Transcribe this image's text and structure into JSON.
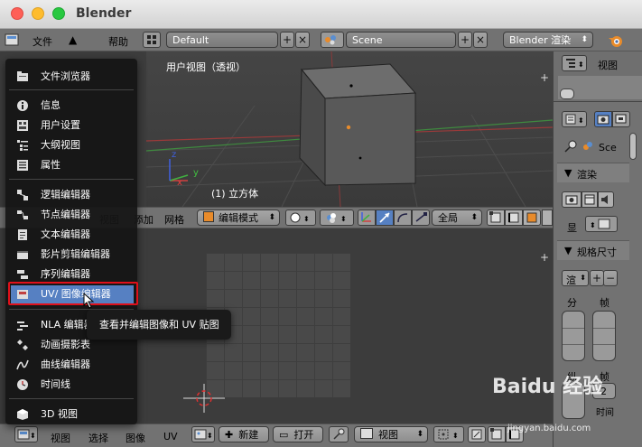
{
  "window": {
    "title": "Blender",
    "traffic_lights": {
      "close": "#fe5f57",
      "minimize": "#febc2e",
      "maximize": "#28c840"
    }
  },
  "top_bar": {
    "file_menu": "文件",
    "add_menu": "添加",
    "help_menu": "帮助",
    "layout": "Default",
    "scene": "Scene",
    "render_engine": "Blender 渲染"
  },
  "viewport": {
    "view_label": "用户视图（透视）",
    "object_label": "(1) 立方体",
    "axis_x": "x",
    "axis_y": "y",
    "axis_z": "z"
  },
  "viewport_header": {
    "view": "视图",
    "add": "添加",
    "mesh": "网格",
    "mode": "编辑模式",
    "orientation": "全局"
  },
  "editor_menu": {
    "items": [
      {
        "label": "文件浏览器",
        "icon": "file-browser-icon"
      },
      {
        "label": "信息",
        "icon": "info-icon"
      },
      {
        "label": "用户设置",
        "icon": "user-preferences-icon"
      },
      {
        "label": "大纲视图",
        "icon": "outliner-icon"
      },
      {
        "label": "属性",
        "icon": "properties-icon"
      },
      {
        "label": "逻辑编辑器",
        "icon": "logic-editor-icon"
      },
      {
        "label": "节点编辑器",
        "icon": "node-editor-icon"
      },
      {
        "label": "文本编辑器",
        "icon": "text-editor-icon"
      },
      {
        "label": "影片剪辑编辑器",
        "icon": "movie-clip-editor-icon"
      },
      {
        "label": "序列编辑器",
        "icon": "sequence-editor-icon"
      },
      {
        "label": "UV/ 图像编辑器",
        "icon": "uv-image-editor-icon"
      },
      {
        "label": "NLA 编辑器",
        "icon": "nla-editor-icon"
      },
      {
        "label": "动画摄影表",
        "icon": "dope-sheet-icon"
      },
      {
        "label": "曲线编辑器",
        "icon": "graph-editor-icon"
      },
      {
        "label": "时间线",
        "icon": "timeline-icon"
      },
      {
        "label": "3D 视图",
        "icon": "3d-view-icon"
      }
    ],
    "highlighted_index": 10,
    "tooltip": "查看并编辑图像和 UV 贴图"
  },
  "uv_header": {
    "view": "视图",
    "select": "选择",
    "image": "图像",
    "uv": "UV",
    "new": "新建",
    "open": "打开",
    "view_mode": "视图"
  },
  "outliner": {
    "view": "视图"
  },
  "properties": {
    "scene_short": "Sce",
    "render_panel": "渲染",
    "display_short": "显",
    "dimensions_panel": "规格尺寸",
    "preset_short": "渲",
    "resolution_short": "分",
    "frames_short": "帧",
    "aspect_short": "纵",
    "frame_rate_short": "帧",
    "step_value": "2",
    "time_short": "时间"
  },
  "watermark": {
    "brand": "Baidu 经验",
    "url": "jingyan.baidu.com"
  },
  "colors": {
    "menu_bg": "#141414",
    "menu_highlight": "#5680c2",
    "callout_red": "#e0101a",
    "header_grey": "#727272"
  }
}
